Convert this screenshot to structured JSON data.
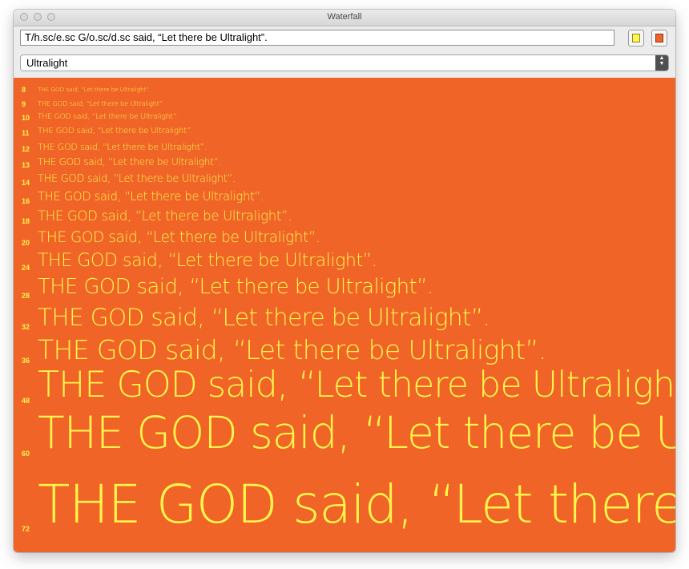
{
  "window": {
    "title": "Waterfall"
  },
  "input": {
    "text": "T/h.sc/e.sc  G/o.sc/d.sc  said, “Let there be Ultralight”."
  },
  "colors": {
    "foreground": "#fff64c",
    "background": "#f06428"
  },
  "font_select": {
    "selected": "Ultralight"
  },
  "waterfall": {
    "sample_text": "THE GOD said, “Let there be Ultralight”.",
    "sizes": [
      "8",
      "9",
      "10",
      "11",
      "12",
      "13",
      "14",
      "16",
      "18",
      "20",
      "24",
      "28",
      "32",
      "36",
      "48",
      "60",
      "72"
    ]
  }
}
